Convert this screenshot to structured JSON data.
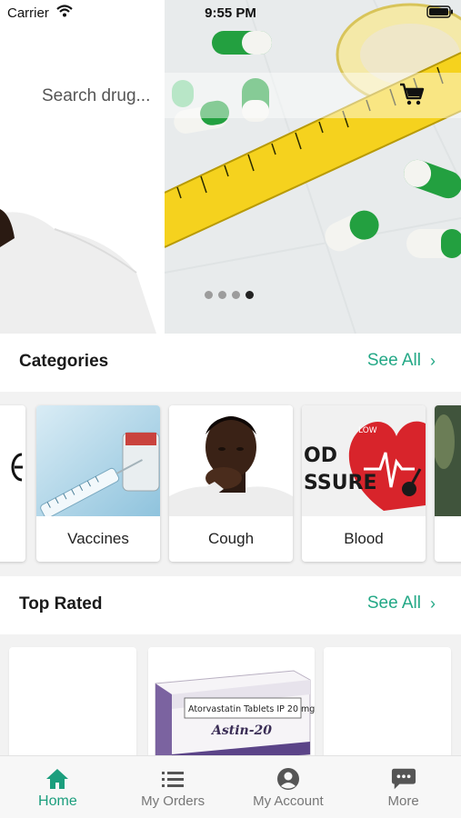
{
  "status_bar": {
    "carrier": "Carrier",
    "time": "9:55 PM"
  },
  "search": {
    "placeholder": "Search drug..."
  },
  "carousel": {
    "dots": 4,
    "active_index": 3
  },
  "categories": {
    "title": "Categories",
    "see_all": "See All",
    "items": [
      {
        "label": "Vaccines"
      },
      {
        "label": "Cough"
      },
      {
        "label": "Blood"
      }
    ],
    "blood_image_text": [
      "OD",
      "SSURE",
      "LOW"
    ]
  },
  "top_rated": {
    "title": "Top Rated",
    "see_all": "See All",
    "product_box_text": {
      "name": "Atorvastatin Tablets IP 20 mg",
      "brand": "Astin-20"
    }
  },
  "tabs": [
    {
      "label": "Home",
      "icon": "home-icon",
      "active": true
    },
    {
      "label": "My Orders",
      "icon": "list-icon",
      "active": false
    },
    {
      "label": "My Account",
      "icon": "account-icon",
      "active": false
    },
    {
      "label": "More",
      "icon": "chat-more-icon",
      "active": false
    }
  ],
  "colors": {
    "accent": "#1b9e7d",
    "see_all": "#23a886",
    "tape_yellow": "#f5d21e",
    "capsule_green": "#23a040"
  }
}
